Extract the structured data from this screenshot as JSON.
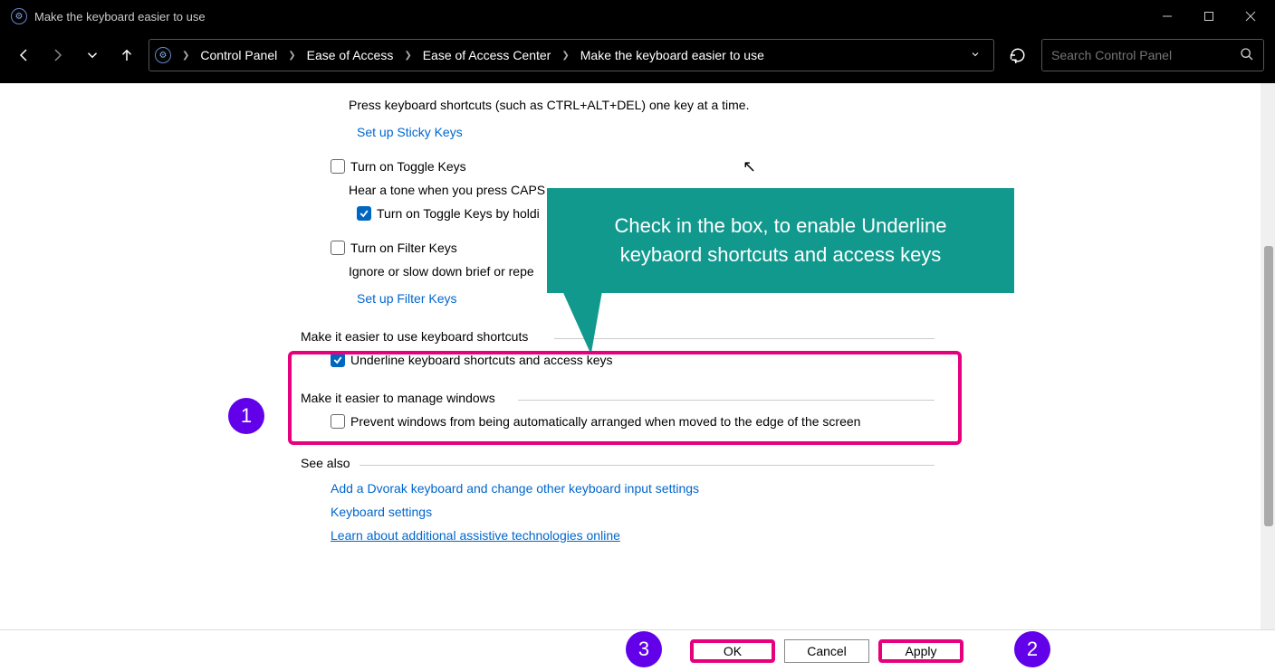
{
  "titlebar": {
    "title": "Make the keyboard easier to use"
  },
  "breadcrumbs": {
    "a": "Control Panel",
    "b": "Ease of Access",
    "c": "Ease of Access Center",
    "d": "Make the keyboard easier to use"
  },
  "search": {
    "placeholder": "Search Control Panel"
  },
  "content": {
    "sticky_desc": "Press keyboard shortcuts (such as CTRL+ALT+DEL) one key at a time.",
    "link_sticky": "Set up Sticky Keys",
    "toggle_keys": "Turn on Toggle Keys",
    "toggle_desc": "Hear a tone when you press CAPS",
    "toggle_hold": "Turn on Toggle Keys by holdi",
    "filter_keys": "Turn on Filter Keys",
    "filter_desc": "Ignore or slow down brief or repe",
    "link_filter": "Set up Filter Keys",
    "section_shortcuts": "Make it easier to use keyboard shortcuts",
    "underline": "Underline keyboard shortcuts and access keys",
    "section_windows": "Make it easier to manage windows",
    "prevent": "Prevent windows from being automatically arranged when moved to the edge of the screen",
    "see_also": "See also",
    "link_dvorak": "Add a Dvorak keyboard and change other keyboard input settings",
    "link_kbd": "Keyboard settings",
    "link_assist": "Learn about additional assistive technologies online"
  },
  "buttons": {
    "ok": "OK",
    "cancel": "Cancel",
    "apply": "Apply"
  },
  "annotations": {
    "tooltip": "Check in the box, to enable Underline keybaord shortcuts and access keys",
    "step1": "1",
    "step2": "2",
    "step3": "3"
  }
}
